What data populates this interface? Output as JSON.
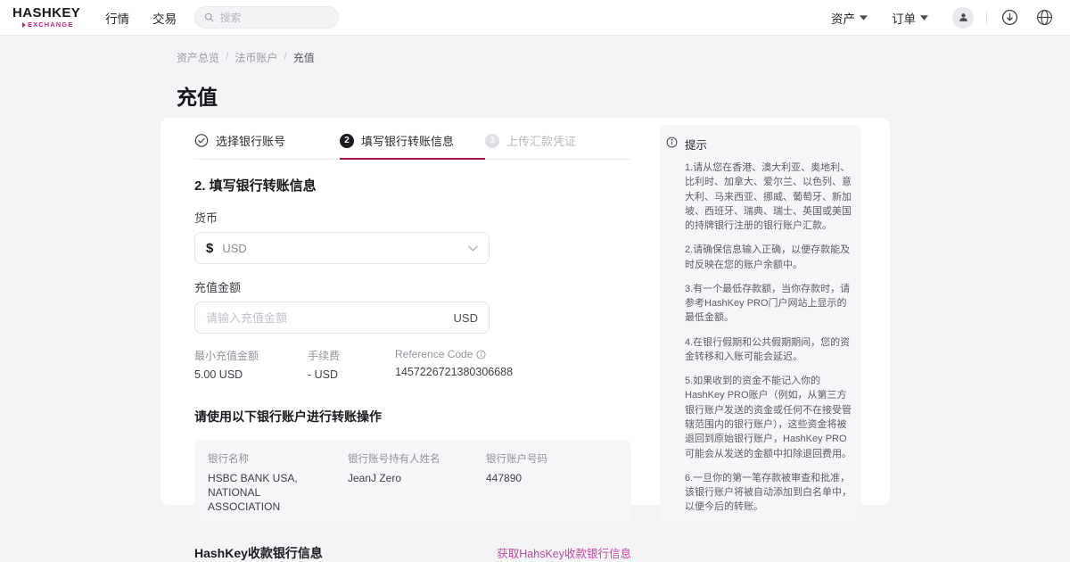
{
  "header": {
    "logo": {
      "line1": "HASHKEY",
      "line2": "EXCHANGE"
    },
    "nav": [
      {
        "label": "行情"
      },
      {
        "label": "交易"
      }
    ],
    "search": {
      "placeholder": "搜索"
    },
    "right": {
      "assets": "资产",
      "orders": "订单"
    }
  },
  "breadcrumb": {
    "items": [
      "资产总览",
      "法币账户",
      "充值"
    ],
    "separator": "/"
  },
  "page_title": "充值",
  "steps": [
    {
      "num": "1",
      "label": "选择银行账号",
      "state": "done"
    },
    {
      "num": "2",
      "label": "填写银行转账信息",
      "state": "active"
    },
    {
      "num": "3",
      "label": "上传汇款凭证",
      "state": "pending"
    }
  ],
  "form": {
    "section_title": "2. 填写银行转账信息",
    "currency": {
      "label": "货币",
      "symbol": "$",
      "value": "USD"
    },
    "amount": {
      "label": "充值金额",
      "placeholder": "请输入充值金额",
      "suffix": "USD"
    },
    "meta": [
      {
        "label": "最小充值金额",
        "value": "5.00 USD"
      },
      {
        "label": "手续费",
        "value": "- USD"
      },
      {
        "label": "Reference Code",
        "value": "1457226721380306688"
      }
    ],
    "transfer_section_title": "请使用以下银行账户进行转账操作",
    "bank_info": [
      {
        "label": "银行名称",
        "value": "HSBC BANK USA, NATIONAL ASSOCIATION"
      },
      {
        "label": "银行账号持有人姓名",
        "value": "JeanJ Zero"
      },
      {
        "label": "银行账户号码",
        "value": "447890"
      }
    ],
    "receiving_bank": {
      "title": "HashKey收款银行信息",
      "link": "获取HahsKey收款银行信息"
    }
  },
  "tips": {
    "title": "提示",
    "items": [
      "1.请从您在香港、澳大利亚、奥地利、比利时、加拿大、爱尔兰、以色列、意大利、马来西亚、挪威、葡萄牙、新加坡、西班牙、瑞典、瑞士、英国或美国的持牌银行注册的银行账户汇款。",
      "2.请确保信息输入正确，以便存款能及时反映在您的账户余额中。",
      "3.有一个最低存款额，当你存款时，请参考HashKey PRO门户网站上显示的最低金额。",
      "4.在银行假期和公共假期期间，您的资金转移和入账可能会延迟。",
      "5.如果收到的资金不能记入你的HashKey PRO账户（例如，从第三方银行账户发送的资金或任何不在接受管辖范围内的银行账户），这些资金将被退回到原始银行账户，HashKey PRO可能会从发送的金额中扣除退回费用。",
      "6.一旦你的第一笔存款被审查和批准，该银行账户将被自动添加到白名单中，以便今后的转账。"
    ]
  },
  "colors": {
    "brand_magenta": "#c2227d",
    "active_step_underline": "#a4125c",
    "link_pink": "#bd4aa0",
    "page_background": "#f4f4f6",
    "panel_background": "#f6f6f9",
    "step_active_circle": "#1b1b20"
  }
}
